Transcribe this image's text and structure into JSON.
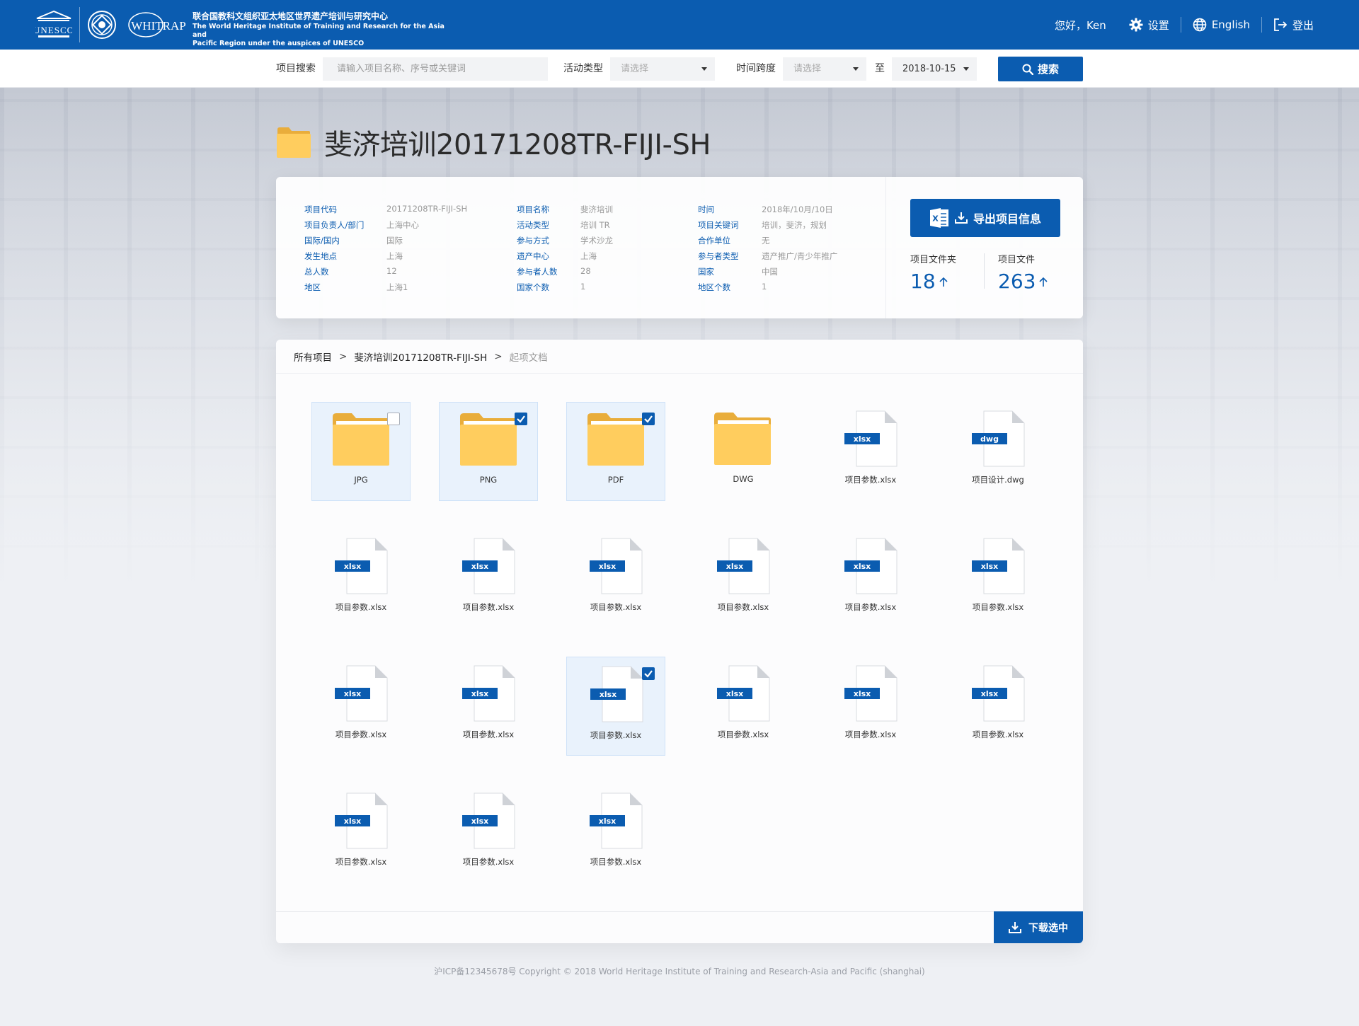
{
  "header": {
    "logo_text": "UNESCO",
    "org_name_cn": "联合国教科文组织亚太地区世界遗产培训与研究中心",
    "org_name_en_line1": "The World Heritage Institute of Training and Research for the Asia and",
    "org_name_en_line2": "Pacific Region under the auspices of UNESCO",
    "greeting": "您好，Ken",
    "settings_label": "设置",
    "language_label": "English",
    "logout_label": "登出"
  },
  "search": {
    "project_label": "项目搜索",
    "project_placeholder": "请输入项目名称、序号或关键词",
    "activity_label": "活动类型",
    "activity_value": "请选择",
    "timespan_label": "时间跨度",
    "timespan_value": "请选择",
    "to_label": "至",
    "end_date": "2018-10-15",
    "search_button": "搜索"
  },
  "project": {
    "title": "斐济培训20171208TR-FIJI-SH",
    "fields": [
      [
        {
          "key": "项目代码",
          "value": "20171208TR-FIJI-SH"
        },
        {
          "key": "项目负责人/部门",
          "value": "上海中心"
        },
        {
          "key": "国际/国内",
          "value": "国际"
        },
        {
          "key": "发生地点",
          "value": "上海"
        },
        {
          "key": "总人数",
          "value": "12"
        },
        {
          "key": "地区",
          "value": "上海1"
        }
      ],
      [
        {
          "key": "项目名称",
          "value": "斐济培训"
        },
        {
          "key": "活动类型",
          "value": "培训  TR"
        },
        {
          "key": "参与方式",
          "value": "学术沙龙"
        },
        {
          "key": "遗产中心",
          "value": "上海"
        },
        {
          "key": "参与者人数",
          "value": "28"
        },
        {
          "key": "国家个数",
          "value": "1"
        }
      ],
      [
        {
          "key": "时间",
          "value": "2018年/10月/10日"
        },
        {
          "key": "项目关键词",
          "value": "培训，斐济，规划"
        },
        {
          "key": "合作单位",
          "value": "无"
        },
        {
          "key": "参与者类型",
          "value": "遗产推广/青少年推广"
        },
        {
          "key": "国家",
          "value": "中国"
        },
        {
          "key": "地区个数",
          "value": "1"
        }
      ]
    ],
    "export_button": "导出项目信息",
    "folder_count_label": "项目文件夹",
    "folder_count": "18",
    "file_count_label": "项目文件",
    "file_count": "263"
  },
  "breadcrumb": {
    "root": "所有项目",
    "project": "斐济培训20171208TR-FIJI-SH",
    "current": "起项文档",
    "separator": ">"
  },
  "files": [
    {
      "type": "folder",
      "name": "JPG",
      "selected": true,
      "checked": false
    },
    {
      "type": "folder",
      "name": "PNG",
      "selected": true,
      "checked": true
    },
    {
      "type": "folder",
      "name": "PDF",
      "selected": true,
      "checked": true
    },
    {
      "type": "folder",
      "name": "DWG",
      "selected": false,
      "checked": false
    },
    {
      "type": "file",
      "ext": "xlsx",
      "name": "项目参数.xlsx",
      "selected": false,
      "checked": false
    },
    {
      "type": "file",
      "ext": "dwg",
      "name": "项目设计.dwg",
      "selected": false,
      "checked": false
    },
    {
      "type": "file",
      "ext": "xlsx",
      "name": "项目参数.xlsx",
      "selected": false,
      "checked": false
    },
    {
      "type": "file",
      "ext": "xlsx",
      "name": "项目参数.xlsx",
      "selected": false,
      "checked": false
    },
    {
      "type": "file",
      "ext": "xlsx",
      "name": "项目参数.xlsx",
      "selected": false,
      "checked": false
    },
    {
      "type": "file",
      "ext": "xlsx",
      "name": "项目参数.xlsx",
      "selected": false,
      "checked": false
    },
    {
      "type": "file",
      "ext": "xlsx",
      "name": "项目参数.xlsx",
      "selected": false,
      "checked": false
    },
    {
      "type": "file",
      "ext": "xlsx",
      "name": "项目参数.xlsx",
      "selected": false,
      "checked": false
    },
    {
      "type": "file",
      "ext": "xlsx",
      "name": "项目参数.xlsx",
      "selected": false,
      "checked": false
    },
    {
      "type": "file",
      "ext": "xlsx",
      "name": "项目参数.xlsx",
      "selected": false,
      "checked": false
    },
    {
      "type": "file",
      "ext": "xlsx",
      "name": "项目参数.xlsx",
      "selected": true,
      "checked": true
    },
    {
      "type": "file",
      "ext": "xlsx",
      "name": "项目参数.xlsx",
      "selected": false,
      "checked": false
    },
    {
      "type": "file",
      "ext": "xlsx",
      "name": "项目参数.xlsx",
      "selected": false,
      "checked": false
    },
    {
      "type": "file",
      "ext": "xlsx",
      "name": "项目参数.xlsx",
      "selected": false,
      "checked": false
    },
    {
      "type": "file",
      "ext": "xlsx",
      "name": "项目参数.xlsx",
      "selected": false,
      "checked": false
    },
    {
      "type": "file",
      "ext": "xlsx",
      "name": "项目参数.xlsx",
      "selected": false,
      "checked": false
    },
    {
      "type": "file",
      "ext": "xlsx",
      "name": "项目参数.xlsx",
      "selected": false,
      "checked": false
    }
  ],
  "download_button": "下载选中",
  "footer": "沪ICP备12345678号 Copyright © 2018 World Heritage Institute of Training and Research-Asia and Pacific (shanghai)",
  "colors": {
    "primary": "#0b5cb0",
    "folder": "#ffcd5e",
    "folder_tab": "#e9ad3b",
    "selected_bg": "#e9f2fc"
  }
}
